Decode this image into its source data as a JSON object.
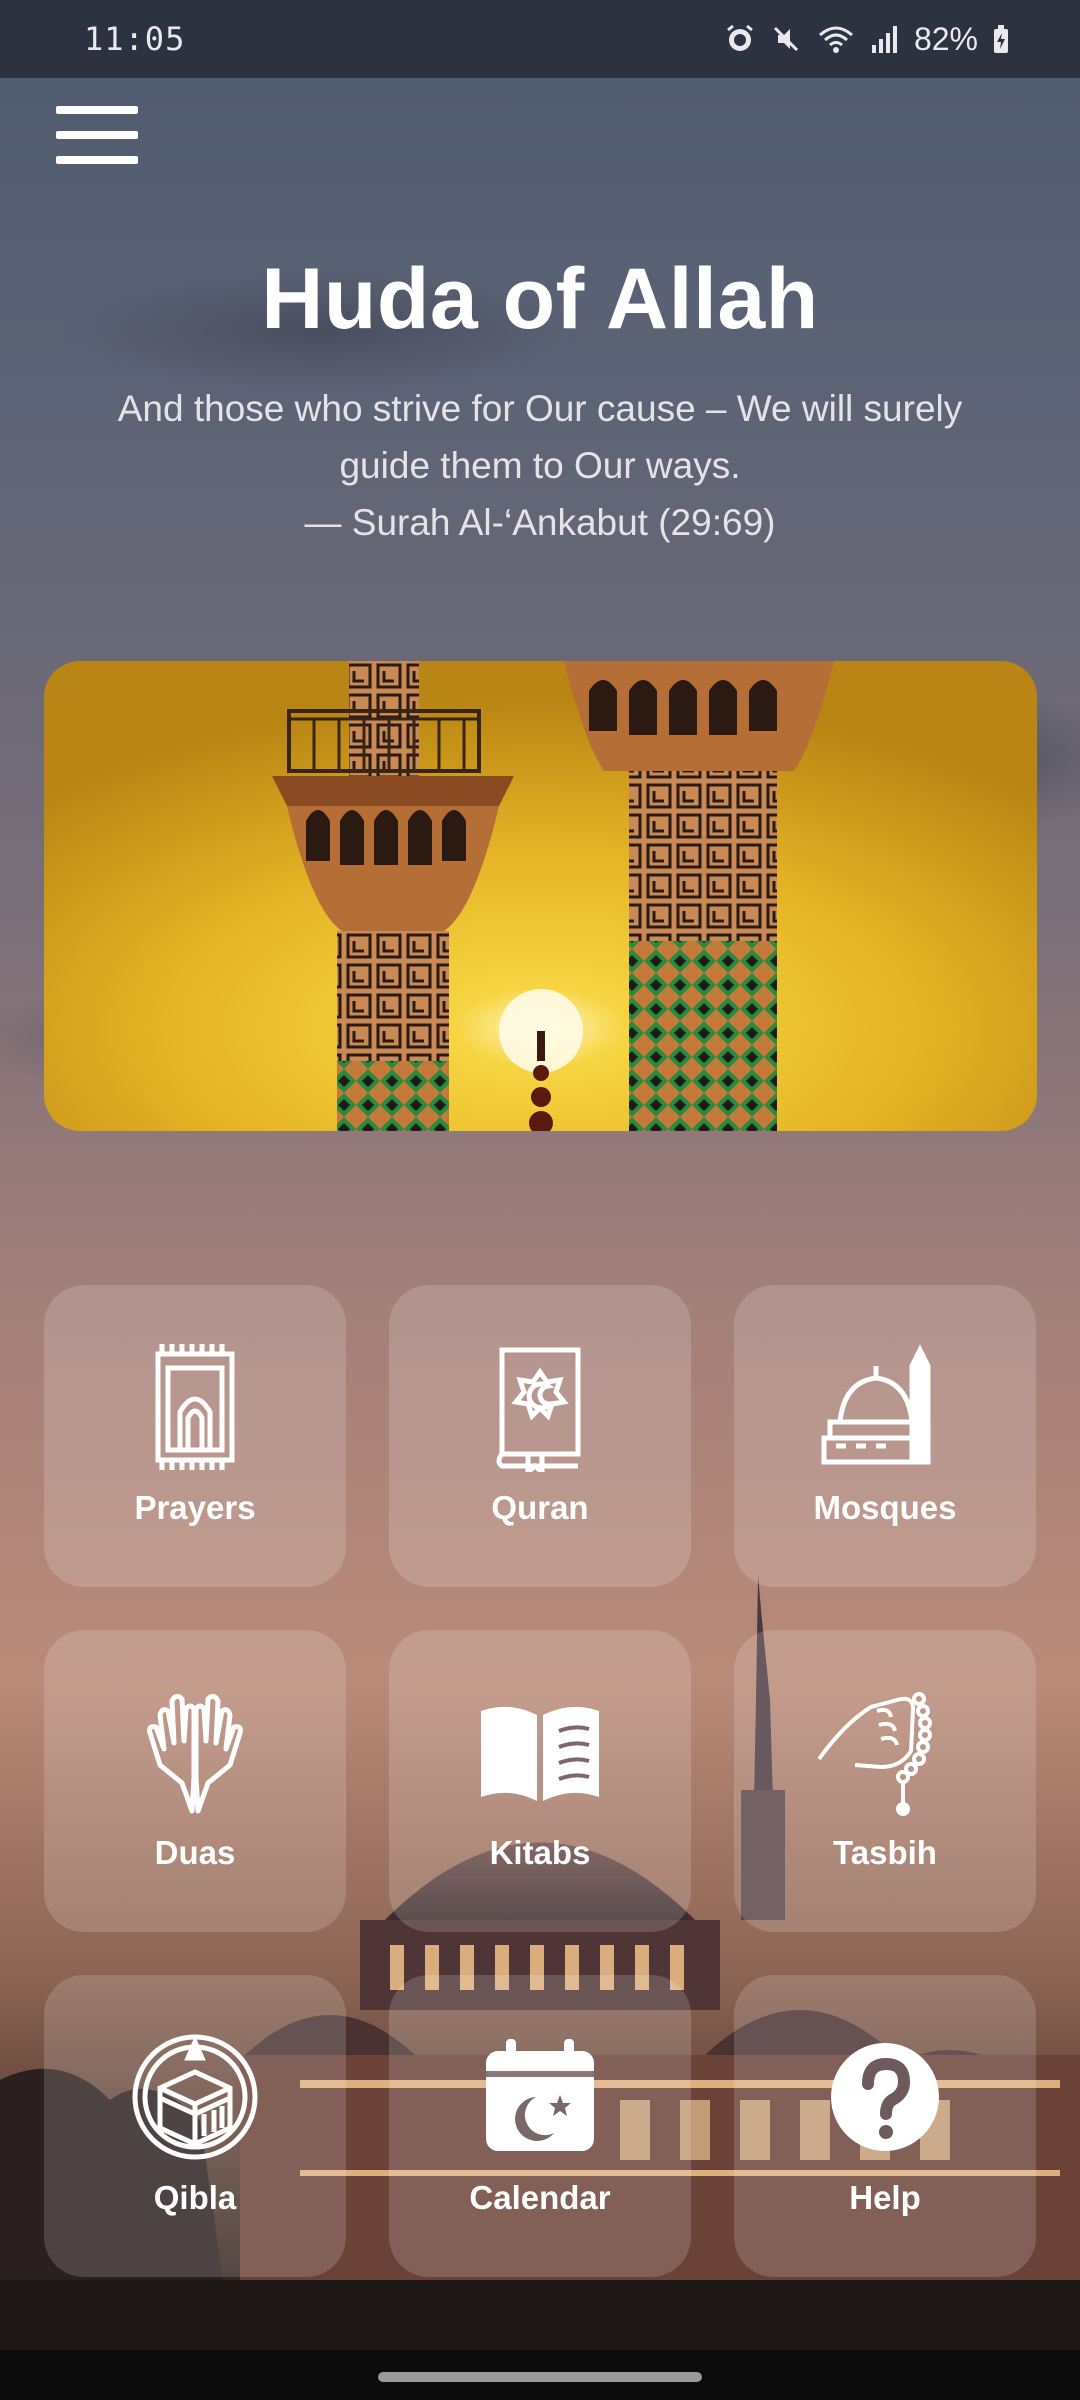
{
  "status_bar": {
    "time": "11:05",
    "battery": "82%"
  },
  "header": {
    "title": "Huda of Allah",
    "quote_line1": "And those who strive for Our cause – We will surely",
    "quote_line2": "guide them to Our ways.",
    "quote_source": "— Surah Al-‘Ankabut (29:69)"
  },
  "tiles": [
    {
      "label": "Prayers",
      "icon": "prayer-mat-icon"
    },
    {
      "label": "Quran",
      "icon": "quran-book-icon"
    },
    {
      "label": "Mosques",
      "icon": "mosque-icon"
    },
    {
      "label": "Duas",
      "icon": "praying-hands-icon"
    },
    {
      "label": "Kitabs",
      "icon": "open-book-icon"
    },
    {
      "label": "Tasbih",
      "icon": "tasbih-hand-icon"
    },
    {
      "label": "Qibla",
      "icon": "kaaba-compass-icon"
    },
    {
      "label": "Calendar",
      "icon": "calendar-moon-icon"
    },
    {
      "label": "Help",
      "icon": "question-icon"
    }
  ],
  "colors": {
    "status_bar": "#2d3240",
    "tile_bg": "rgba(255,255,255,0.16)",
    "hero_gold": "#e3b21c"
  }
}
